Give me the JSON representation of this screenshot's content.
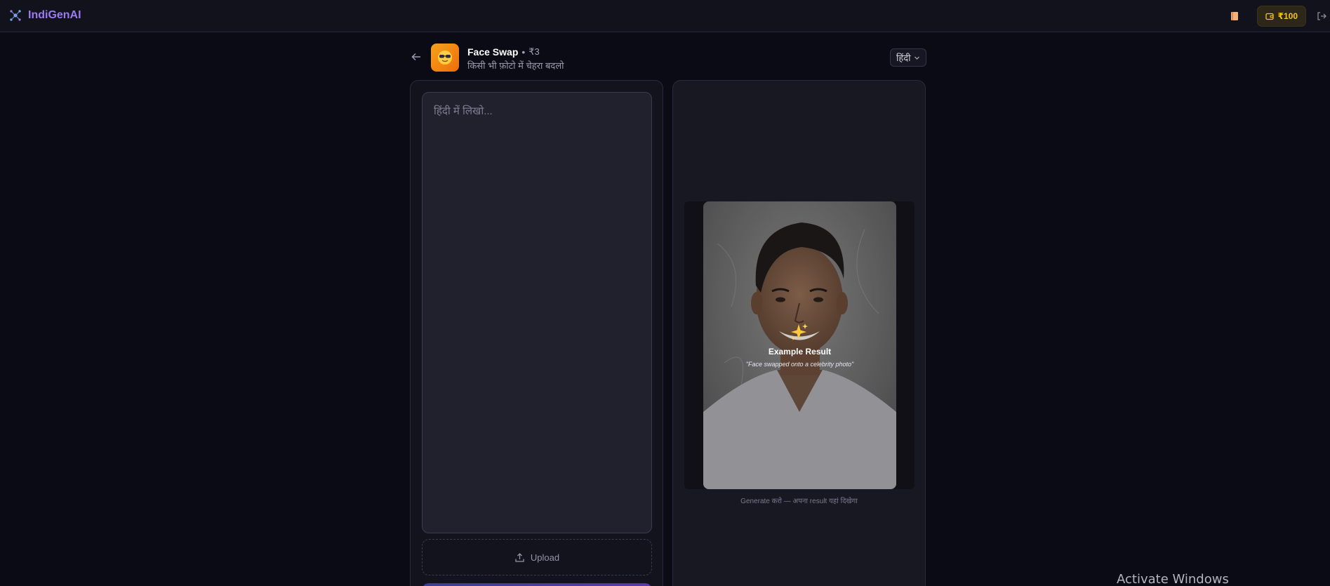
{
  "app": {
    "brand_name": "IndiGenAI",
    "brand_color": "#9b7bf0",
    "icons": [
      "sparkle-grid-icon",
      "book-icon",
      "wallet-icon",
      "logout-icon"
    ]
  },
  "header": {
    "wallet_balance": "₹100",
    "wallet_color": "#f5c518"
  },
  "tool": {
    "title": "Face Swap",
    "separator": "•",
    "price": "₹3",
    "subtitle": "किसी भी फ़ोटो में चेहरा बदलो",
    "icon": "face-with-sunglasses-icon",
    "icon_colors": [
      "#f6a21a",
      "#ee6d0f"
    ],
    "language": "हिंदी"
  },
  "input": {
    "placeholder": "हिंदी में लिखो...",
    "value": "",
    "upload_label": "Upload"
  },
  "preview": {
    "sparkle": "✨",
    "example_title": "Example Result",
    "example_caption": "\"Face swapped onto a celebrity photo\"",
    "hint": "Generate करो — अपना result यहां दिखेगा"
  },
  "system": {
    "watermark": "Activate Windows"
  }
}
